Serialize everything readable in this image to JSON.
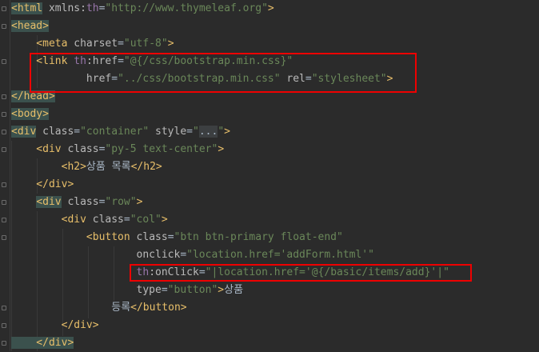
{
  "editor": {
    "lines": [
      {
        "tokens": [
          {
            "t": "<html",
            "c": "tag",
            "hl": true
          },
          {
            "t": " xmlns:",
            "c": "attr"
          },
          {
            "t": "th",
            "c": "ns"
          },
          {
            "t": "=",
            "c": "punc"
          },
          {
            "t": "\"http://www.thymeleaf.org\"",
            "c": "str"
          },
          {
            "t": ">",
            "c": "tag"
          }
        ]
      },
      {
        "tokens": [
          {
            "t": "<head>",
            "c": "tag",
            "hl": true
          }
        ]
      },
      {
        "tokens": [
          {
            "t": "    <meta",
            "c": "tag"
          },
          {
            "t": " charset",
            "c": "attr"
          },
          {
            "t": "=",
            "c": "punc"
          },
          {
            "t": "\"utf-8\"",
            "c": "str"
          },
          {
            "t": ">",
            "c": "tag"
          }
        ]
      },
      {
        "tokens": [
          {
            "t": "    <link ",
            "c": "tag"
          },
          {
            "t": "th",
            "c": "ns"
          },
          {
            "t": ":href",
            "c": "attr"
          },
          {
            "t": "=",
            "c": "punc"
          },
          {
            "t": "\"@{/css/bootstrap.min.css}\"",
            "c": "str"
          }
        ]
      },
      {
        "tokens": [
          {
            "t": "            href",
            "c": "attr"
          },
          {
            "t": "=",
            "c": "punc"
          },
          {
            "t": "\"../css/bootstrap.min.css\"",
            "c": "str"
          },
          {
            "t": " rel",
            "c": "attr"
          },
          {
            "t": "=",
            "c": "punc"
          },
          {
            "t": "\"stylesheet\"",
            "c": "str"
          },
          {
            "t": ">",
            "c": "tag"
          }
        ]
      },
      {
        "tokens": [
          {
            "t": "</head>",
            "c": "tag",
            "hl": true
          }
        ]
      },
      {
        "tokens": [
          {
            "t": "<body>",
            "c": "tag",
            "hl": true
          }
        ]
      },
      {
        "tokens": [
          {
            "t": "<div",
            "c": "tag",
            "hl": true
          },
          {
            "t": " class",
            "c": "attr"
          },
          {
            "t": "=",
            "c": "punc"
          },
          {
            "t": "\"container\"",
            "c": "str"
          },
          {
            "t": " style",
            "c": "attr"
          },
          {
            "t": "=",
            "c": "punc"
          },
          {
            "t": "\"",
            "c": "str"
          },
          {
            "t": "...",
            "c": "ellipsis"
          },
          {
            "t": "\"",
            "c": "str"
          },
          {
            "t": ">",
            "c": "tag"
          }
        ]
      },
      {
        "tokens": [
          {
            "t": "    <div",
            "c": "tag"
          },
          {
            "t": " class",
            "c": "attr"
          },
          {
            "t": "=",
            "c": "punc"
          },
          {
            "t": "\"py-5 text-center\"",
            "c": "str"
          },
          {
            "t": ">",
            "c": "tag"
          }
        ]
      },
      {
        "tokens": [
          {
            "t": "        <h2>",
            "c": "tag"
          },
          {
            "t": "상품 목록",
            "c": "text"
          },
          {
            "t": "</h2>",
            "c": "tag"
          }
        ]
      },
      {
        "tokens": [
          {
            "t": "    </div>",
            "c": "tag"
          }
        ]
      },
      {
        "tokens": [
          {
            "t": "    ",
            "c": "text"
          },
          {
            "t": "<div",
            "c": "tag",
            "hl": true
          },
          {
            "t": " class",
            "c": "attr"
          },
          {
            "t": "=",
            "c": "punc"
          },
          {
            "t": "\"row\"",
            "c": "str"
          },
          {
            "t": ">",
            "c": "tag"
          }
        ]
      },
      {
        "tokens": [
          {
            "t": "        <div",
            "c": "tag"
          },
          {
            "t": " class",
            "c": "attr"
          },
          {
            "t": "=",
            "c": "punc"
          },
          {
            "t": "\"col\"",
            "c": "str"
          },
          {
            "t": ">",
            "c": "tag"
          }
        ]
      },
      {
        "tokens": [
          {
            "t": "            <button",
            "c": "tag"
          },
          {
            "t": " class",
            "c": "attr"
          },
          {
            "t": "=",
            "c": "punc"
          },
          {
            "t": "\"btn btn-primary float-end\"",
            "c": "str"
          }
        ]
      },
      {
        "tokens": [
          {
            "t": "                    onclick",
            "c": "attr"
          },
          {
            "t": "=",
            "c": "punc"
          },
          {
            "t": "\"location.href='addForm.html'\"",
            "c": "str"
          }
        ]
      },
      {
        "tokens": [
          {
            "t": "                    ",
            "c": "text"
          },
          {
            "t": "th",
            "c": "ns"
          },
          {
            "t": ":onClick",
            "c": "attr"
          },
          {
            "t": "=",
            "c": "punc"
          },
          {
            "t": "\"|location.href='@{/basic/items/add}'|\"",
            "c": "str"
          }
        ]
      },
      {
        "tokens": [
          {
            "t": "                    type",
            "c": "attr"
          },
          {
            "t": "=",
            "c": "punc"
          },
          {
            "t": "\"button\"",
            "c": "str"
          },
          {
            "t": ">",
            "c": "tag"
          },
          {
            "t": "상품",
            "c": "text"
          }
        ]
      },
      {
        "tokens": [
          {
            "t": "                ",
            "c": "text"
          },
          {
            "t": "등록",
            "c": "text"
          },
          {
            "t": "</button>",
            "c": "tag"
          }
        ]
      },
      {
        "tokens": [
          {
            "t": "        </div>",
            "c": "tag"
          }
        ]
      },
      {
        "tokens": [
          {
            "t": "    </div>",
            "c": "tag",
            "hl": true
          }
        ]
      }
    ]
  },
  "colors": {
    "background": "#2b2b2b",
    "tag": "#e8bf6a",
    "attribute": "#bababa",
    "namespace": "#9876aa",
    "string": "#6a8759",
    "highlight_box": "#e00000"
  }
}
